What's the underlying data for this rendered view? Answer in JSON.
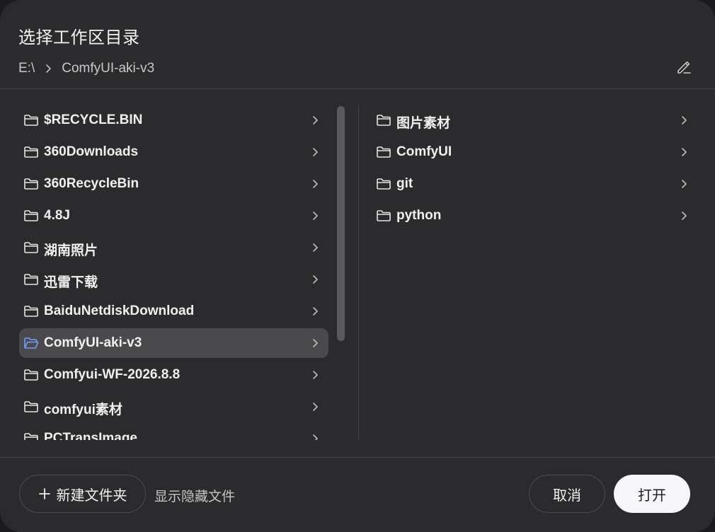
{
  "dialog": {
    "title": "选择工作区目录",
    "colors": {
      "background": "#2b2b2d",
      "selected_row": "#4a4a4d",
      "accent_folder": "#6ea0ff"
    }
  },
  "breadcrumb": {
    "items": [
      "E:\\",
      "ComfyUI-aki-v3"
    ],
    "separator_icon": "chevron-right-icon",
    "edit_icon": "pencil-icon"
  },
  "left_column": {
    "items": [
      {
        "label": "$RECYCLE.BIN"
      },
      {
        "label": "360Downloads"
      },
      {
        "label": "360RecycleBin"
      },
      {
        "label": "4.8J"
      },
      {
        "label": "湖南照片"
      },
      {
        "label": "迅雷下载"
      },
      {
        "label": "BaiduNetdiskDownload"
      },
      {
        "label": "ComfyUI-aki-v3",
        "selected": true
      },
      {
        "label": "Comfyui-WF-2026.8.8"
      },
      {
        "label": "comfyui素材"
      },
      {
        "label": "PCTransImage"
      }
    ]
  },
  "right_column": {
    "items": [
      {
        "label": "图片素材"
      },
      {
        "label": "ComfyUI"
      },
      {
        "label": "git"
      },
      {
        "label": "python"
      }
    ]
  },
  "footer": {
    "new_folder_label": "新建文件夹",
    "show_hidden_label": "显示隐藏文件",
    "cancel_label": "取消",
    "open_label": "打开"
  }
}
